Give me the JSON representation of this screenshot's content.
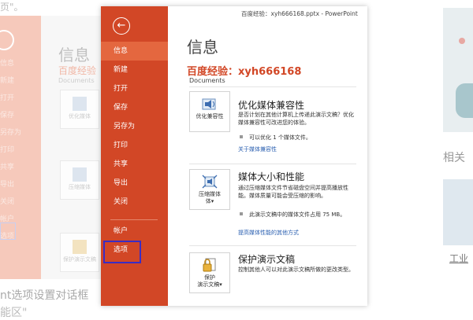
{
  "background": {
    "top_text": "页\"。",
    "ppt_side_items": [
      "信息",
      "新建",
      "打开",
      "保存",
      "另存为",
      "打印",
      "共享",
      "导出",
      "关闭",
      "帐户",
      "选项"
    ],
    "ppt_title": "信息",
    "ppt_subtitle": "百度经验",
    "ppt_docs": "Documents",
    "ppt_btn1": "优化媒体",
    "ppt_btn2": "压缩媒体",
    "ppt_btn3": "保护演示文稿",
    "caption_line1": "nt选项设置对话框",
    "caption_line2": "能区\"",
    "related_label": "相关",
    "industrial_link": "工业"
  },
  "window": {
    "title": "百度经验：xyh666168.pptx - PowerPoint"
  },
  "sidebar": {
    "back_icon": "back-arrow-icon",
    "items": [
      {
        "label": "信息",
        "active": true
      },
      {
        "label": "新建",
        "active": false
      },
      {
        "label": "打开",
        "active": false
      },
      {
        "label": "保存",
        "active": false
      },
      {
        "label": "另存为",
        "active": false
      },
      {
        "label": "打印",
        "active": false
      },
      {
        "label": "共享",
        "active": false
      },
      {
        "label": "导出",
        "active": false
      },
      {
        "label": "关闭",
        "active": false
      }
    ],
    "account_label": "帐户",
    "options_label": "选项"
  },
  "main": {
    "title": "信息",
    "subtitle": "百度经验：xyh666168",
    "location": "Documents",
    "blocks": [
      {
        "button_label": "优化兼容性",
        "icon": "media-compat-icon",
        "title": "优化媒体兼容性",
        "description": "是否计划在其他计算机上传递此演示文稿？优化媒体兼容性可改进您的体验。",
        "bullet": "可以优化 1 个媒体文件。",
        "link": "关于媒体兼容性"
      },
      {
        "button_label": "压缩媒体",
        "button_label2": "体",
        "icon": "compress-media-icon",
        "title": "媒体大小和性能",
        "description": "通过压缩媒体文件节省磁盘空间并提高播放性能。媒体质量可能会受压缩的影响。",
        "bullet": "此演示文稿中的媒体文件占用 75 MB。",
        "link": "提高媒体性能的其他方式"
      },
      {
        "button_label": "保护",
        "button_label2": "演示文稿",
        "icon": "lock-document-icon",
        "title": "保护演示文稿",
        "description": "控制其他人可以对此演示文稿所做的更改类型。"
      }
    ]
  },
  "colors": {
    "accent": "#d24726",
    "active_item": "#e4673f",
    "highlight_box": "#3a2cc4",
    "link": "#2a5fb0"
  }
}
